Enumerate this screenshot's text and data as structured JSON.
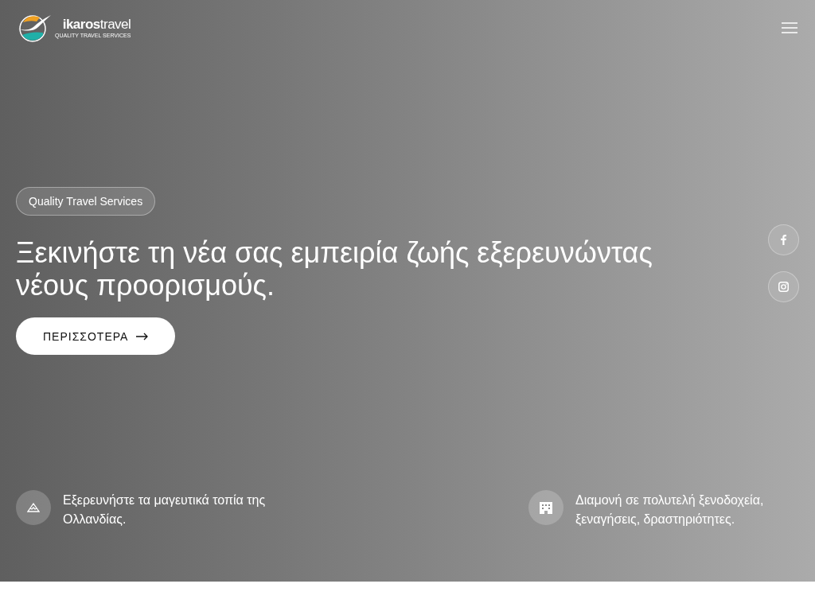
{
  "logo": {
    "name": "**ikaros**travel",
    "tagline": "QUALITY TRAVEL SERVICES"
  },
  "hero": {
    "badge": "Quality Travel Services",
    "heading": "Ξεκινήστε τη νέα σας εμπειρία ζωής εξερευνώντας νέους προορισμούς.",
    "button": "ΠΕΡΙΣΣΟΤΕΡΑ"
  },
  "social": [
    {
      "kind": "facebook"
    },
    {
      "kind": "instagram"
    }
  ],
  "features": [
    {
      "kind": "mountain",
      "text": "Εξερευνήστε τα μαγευτικά τοπία της Ολλανδίας."
    },
    {
      "kind": "hotel",
      "text": "Διαμονή σε πολυτελή ξενοδοχεία, ξεναγήσεις, δραστηριότητες."
    }
  ]
}
